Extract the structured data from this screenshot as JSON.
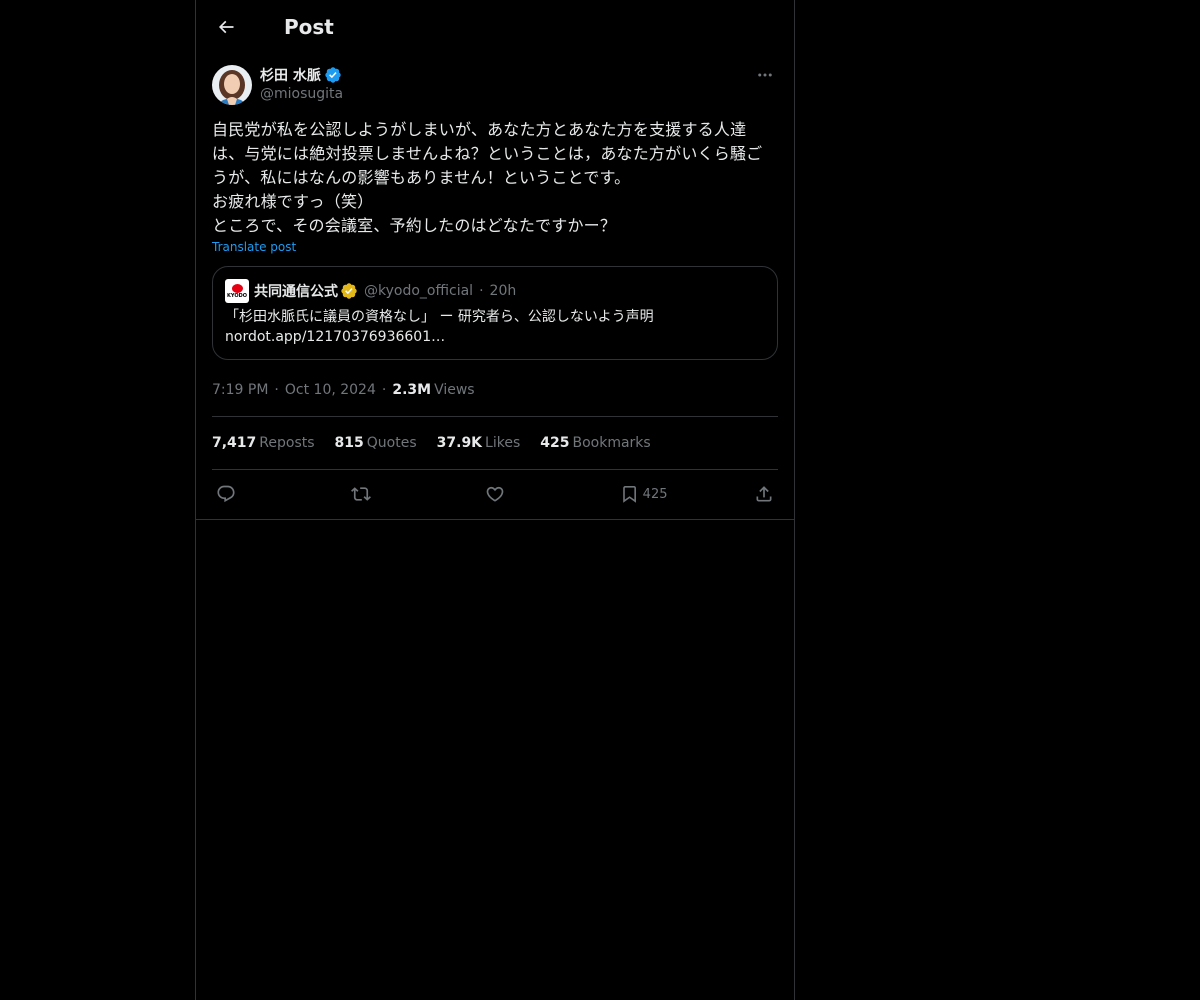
{
  "header": {
    "title": "Post"
  },
  "author": {
    "display_name": "杉田 水脈",
    "handle": "@miosugita",
    "verified_color": "#1d9bf0"
  },
  "post": {
    "text": "自民党が私を公認しようがしまいが、あなた方とあなた方を支援する人達は、与党には絶対投票しませんよね？ということは，あなた方がいくら騒ごうが、私にはなんの影響もありません！ということです。\nお疲れ様ですっ（笑）\nところで、その会議室、予約したのはどなたですかー？",
    "translate_label": "Translate post"
  },
  "quote": {
    "display_name": "共同通信公式",
    "handle": "@kyodo_official",
    "time": "20h",
    "logo_text": "KYODO",
    "verified_color": "#e2b719",
    "body_line1": "「杉田水脈氏に議員の資格なし」 ー 研究者ら、公認しないよう声明",
    "body_line2": "nordot.app/12170376936601…"
  },
  "meta": {
    "time": "7:19 PM",
    "date": "Oct 10, 2024",
    "views_count": "2.3M",
    "views_label": "Views"
  },
  "stats": {
    "reposts_count": "7,417",
    "reposts_label": "Reposts",
    "quotes_count": "815",
    "quotes_label": "Quotes",
    "likes_count": "37.9K",
    "likes_label": "Likes",
    "bookmarks_count": "425",
    "bookmarks_label": "Bookmarks"
  },
  "actions": {
    "reply_icon": "reply-icon",
    "repost_icon": "repost-icon",
    "like_icon": "heart-icon",
    "bookmark_icon": "bookmark-icon",
    "bookmark_count": "425",
    "share_icon": "share-icon"
  }
}
